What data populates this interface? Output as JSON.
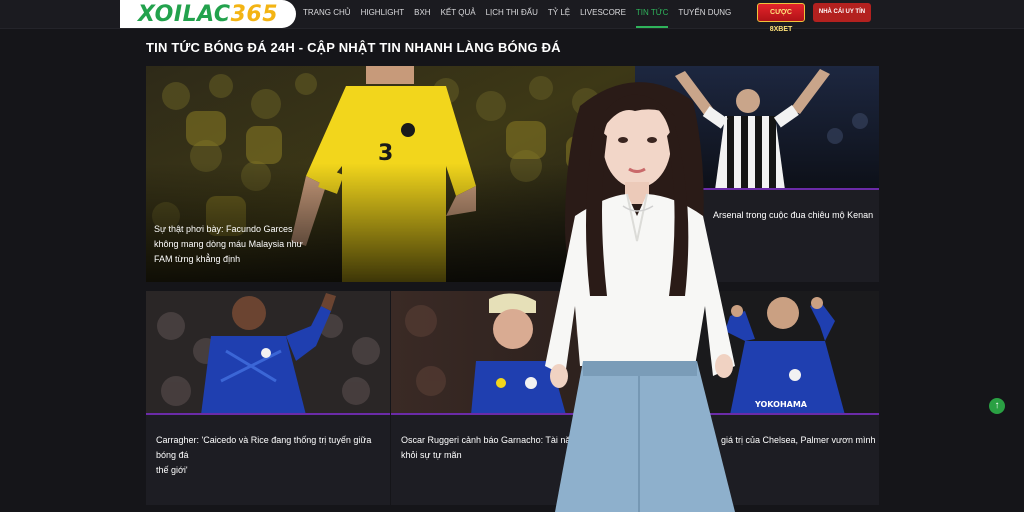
{
  "header": {
    "logo_part1": "XOILAC",
    "logo_part2": "365",
    "nav": [
      "TRANG CHỦ",
      "HIGHLIGHT",
      "BXH",
      "KẾT QUẢ",
      "LỊCH THI ĐẤU",
      "TỶ LỆ",
      "LIVESCORE",
      "TIN TỨC",
      "TUYỂN DỤNG"
    ],
    "active_nav_index": 7,
    "btn_cuoc": "CƯỢC 8XBET",
    "btn_nha_cai": "NHÀ CÁI UY TÍN"
  },
  "page_title": "TIN TỨC BÓNG ĐÁ 24H - CẬP NHẬT TIN NHANH LÀNG BÓNG ĐÁ",
  "articles": {
    "featured": {
      "line1": "Sự thật phơi bày: Facundo Garces",
      "line2": "không mang dòng máu Malaysia như",
      "line3": "FAM từng khẳng định",
      "jersey_number": "3"
    },
    "side": {
      "title": "Arsenal trong cuộc đua chiêu mộ Kenan"
    },
    "card1": {
      "line1": "Carragher: 'Caicedo và Rice đang thống trị tuyến giữa bóng đá",
      "line2": "thế giới'"
    },
    "card2": {
      "line1": "Oscar Ruggeri cảnh báo Garnacho: Tài năng khô",
      "line2": "khỏi sự tự mãn"
    },
    "card3": {
      "line1": "giá trị của Chelsea, Palmer vươn mình"
    }
  },
  "colors": {
    "accent_green": "#2fb35b",
    "brand_yellow": "#f3b414",
    "chelsea_blue": "#1f3fb0",
    "malaysia_yellow": "#f2d61c"
  },
  "icons": {
    "scroll_top": "arrow-up-icon"
  },
  "scroll_top_glyph": "↑"
}
